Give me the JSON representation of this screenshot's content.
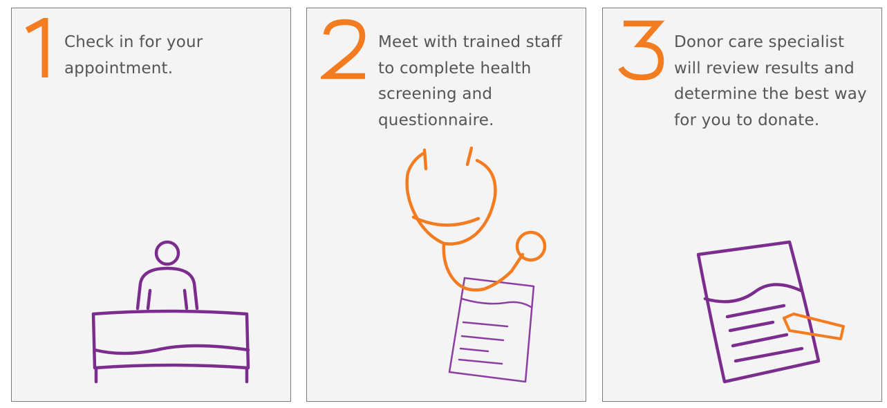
{
  "colors": {
    "accent_orange": "#f47c20",
    "illustration_purple": "#7b2d8e",
    "card_background": "#f4f4f4",
    "card_border": "#7a7a7a",
    "body_text": "#555555"
  },
  "steps": [
    {
      "number": "1",
      "text": "Check in for your appointment.",
      "illustration": "reception-desk-icon"
    },
    {
      "number": "2",
      "text": "Meet with trained staff to complete health screening and questionnaire.",
      "illustration": "stethoscope-clipboard-icon"
    },
    {
      "number": "3",
      "text": "Donor care specialist will review results and determine the best way for you to donate.",
      "illustration": "document-pencil-icon"
    }
  ]
}
